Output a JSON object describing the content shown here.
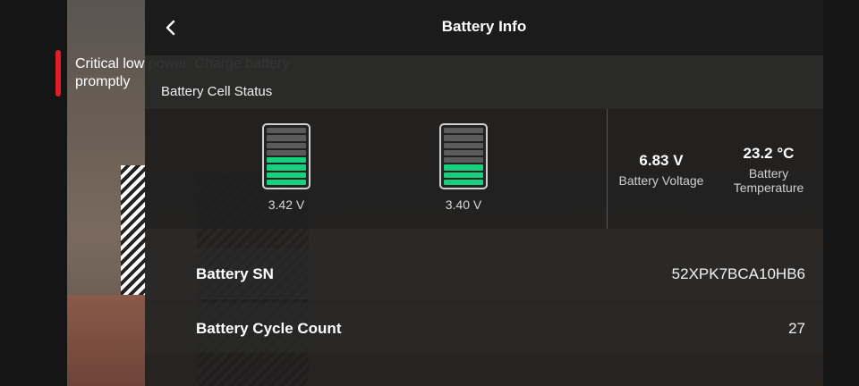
{
  "warning": {
    "text_line1": "Critical low power. Charge battery",
    "text_line2": "promptly",
    "color": "#e11d2a"
  },
  "header": {
    "title": "Battery Info",
    "back_icon": "chevron-left-icon"
  },
  "cell_status": {
    "section_title": "Battery Cell Status",
    "cells": [
      {
        "voltage": "3.42 V",
        "level_segments_filled": 4,
        "segments_total": 8
      },
      {
        "voltage": "3.40 V",
        "level_segments_filled": 3,
        "segments_total": 8
      }
    ],
    "accent_color": "#16d07d"
  },
  "stats": {
    "voltage_value": "6.83 V",
    "voltage_label": "Battery Voltage",
    "temperature_value": "23.2 °C",
    "temperature_label_line1": "Battery",
    "temperature_label_line2": "Temperature"
  },
  "details": {
    "sn_label": "Battery SN",
    "sn_value": "52XPK7BCA10HB6",
    "cycle_label": "Battery Cycle Count",
    "cycle_value": "27"
  }
}
